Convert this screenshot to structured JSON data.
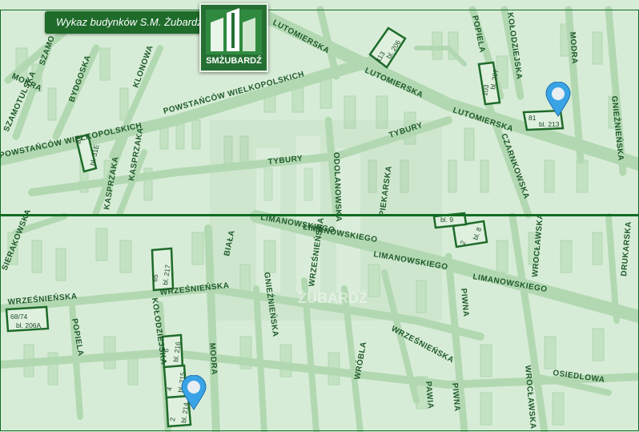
{
  "title": "Wykaz budynków S.M. Żubardź",
  "logo_text": "SMŻUBARDŹ",
  "watermark": "ŻUBARDŹ",
  "colors": {
    "map_bg": "#d7ecd7",
    "road": "#b2d8b2",
    "block": "#c2e2c2",
    "dark_green": "#1e6b2a",
    "pin": "#3aa3e6"
  },
  "top_panel": {
    "streets": [
      "MOKRA",
      "SZAMOTULSKA",
      "BYDGOSKA",
      "KLONOWA",
      "SZAMO",
      "POWSTAŃCÓW WIELKOPOLSKICH",
      "POWSTAŃCÓW WIELKOPOLSKICH",
      "LUTOMIERSKA",
      "LUTOMIERSKA",
      "LUTOMIERSKA",
      "TYBURY",
      "TYBURY",
      "KASPRZAKA",
      "KASPRZAKA",
      "ODOLANOWSKA",
      "POPIELA",
      "KOŁODZIEJSKA",
      "MODRA",
      "GNIEŹNIEŃSKA",
      "CZARNKOWSKA"
    ],
    "buildings": [
      {
        "no": "22",
        "label": "bl. 31E"
      },
      {
        "no": "113",
        "label": "bl. 206"
      },
      {
        "no": "103",
        "label": "bl. 207"
      },
      {
        "no": "81",
        "label": "bl. 213"
      }
    ]
  },
  "bottom_panel": {
    "streets": [
      "SIERAKOWSKA",
      "WRZEŚNIEŃSKA",
      "WRZEŚNIEŃSKA",
      "WRZEŚNIEŃSKA",
      "BIAŁA",
      "GNIEŹNIEŃSKA",
      "WRZEŚNIEŃSKA",
      "LIMANOWSKIEGO",
      "LIMANOWSKIEGO",
      "LIMANOWSKIEGO",
      "LIMANOWSKIEGO",
      "PIEKARSKA",
      "PIWNA",
      "PIWNA",
      "WRÓBLA",
      "PAWIA",
      "WROCŁAWSKA",
      "WROCŁAWSKA",
      "DRUKARSKA",
      "OSIEDLOWA",
      "POPIELA",
      "KOŁODZIEJSKA",
      "MODRA"
    ],
    "buildings": [
      {
        "no": "65",
        "label": "bl. 217"
      },
      {
        "no": "68/74",
        "label": "bl. 206A"
      },
      {
        "no": "6",
        "label": "bl. 216"
      },
      {
        "no": "4",
        "label": "bl. 215"
      },
      {
        "no": "2",
        "label": "bl. 214"
      },
      {
        "no": "2",
        "label": "bl. 8"
      },
      {
        "no": "",
        "label": "bl. 9"
      }
    ]
  }
}
